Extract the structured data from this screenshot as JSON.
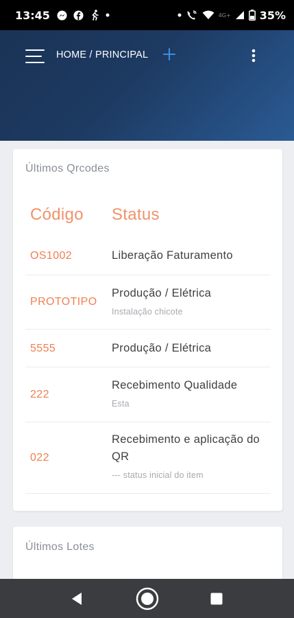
{
  "status_bar": {
    "time": "13:45",
    "left_icons": [
      "messenger-icon",
      "facebook-icon",
      "running-icon",
      "dot-icon"
    ],
    "right_icons": [
      "dot-icon",
      "wifi-calling-icon",
      "wifi-icon",
      "signal-icon",
      "battery-icon"
    ],
    "lte_label": "4G+",
    "battery": "35%"
  },
  "app_bar": {
    "breadcrumb": "HOME / PRINCIPAL",
    "colors": {
      "gradient_start": "#1a3356",
      "gradient_end": "#2a5b94",
      "plus": "#3d8fe0"
    }
  },
  "qrcodes_card": {
    "title": "Últimos Qrcodes",
    "headers": {
      "code": "Código",
      "status": "Status"
    },
    "rows": [
      {
        "code": "OS1002",
        "status": "Liberação Faturamento",
        "sub": ""
      },
      {
        "code": "PROTOTIPO",
        "status": "Produção / Elétrica",
        "sub": "Instalação chicote"
      },
      {
        "code": "5555",
        "status": "Produção / Elétrica",
        "sub": ""
      },
      {
        "code": "222",
        "status": "Recebimento Qualidade",
        "sub": "Esta"
      },
      {
        "code": "022",
        "status": "Recebimento e aplicação do QR",
        "sub": "--- status inicial do item"
      }
    ]
  },
  "lotes_card": {
    "title": "Últimos Lotes"
  },
  "accent_color": "#ef7f52"
}
